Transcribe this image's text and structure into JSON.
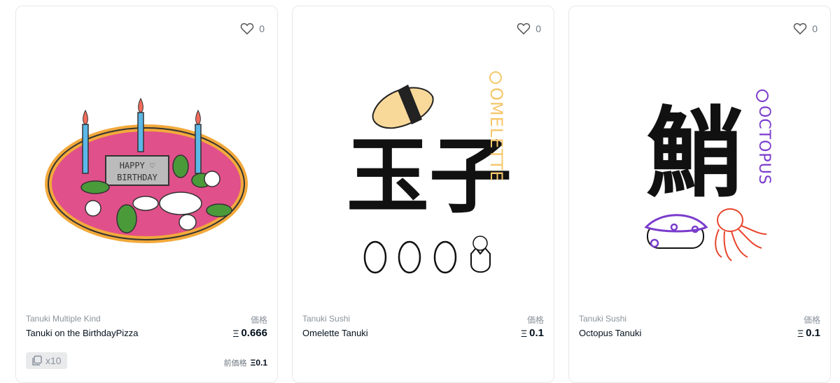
{
  "cards": [
    {
      "likes": "0",
      "collection": "Tanuki Multiple Kind",
      "price_label": "価格",
      "name": "Tanuki on the BirthdayPizza",
      "currency": "Ξ",
      "price": "0.666",
      "editions": "x10",
      "prev_price_label": "前価格",
      "prev_price": "0.1",
      "art_text": {
        "line1": "HAPPY ♡",
        "line2": "BIRTHDAY"
      }
    },
    {
      "likes": "0",
      "collection": "Tanuki Sushi",
      "price_label": "価格",
      "name": "Omelette Tanuki",
      "currency": "Ξ",
      "price": "0.1",
      "art_text": {
        "kanji": "玉子",
        "vertical": "OMELETTE"
      }
    },
    {
      "likes": "0",
      "collection": "Tanuki Sushi",
      "price_label": "価格",
      "name": "Octopus Tanuki",
      "currency": "Ξ",
      "price": "0.1",
      "art_text": {
        "kanji": "鮹",
        "vertical": "OCTOPUS"
      }
    }
  ],
  "colors": {
    "pizza_crust": "#f2a93b",
    "pizza_sauce": "#e0508a",
    "omelette_yellow": "#f8d99a",
    "octopus_purple": "#7a3ccc",
    "octopus_red": "#e8452c"
  },
  "icons": [
    "heart-icon",
    "editions-icon"
  ]
}
